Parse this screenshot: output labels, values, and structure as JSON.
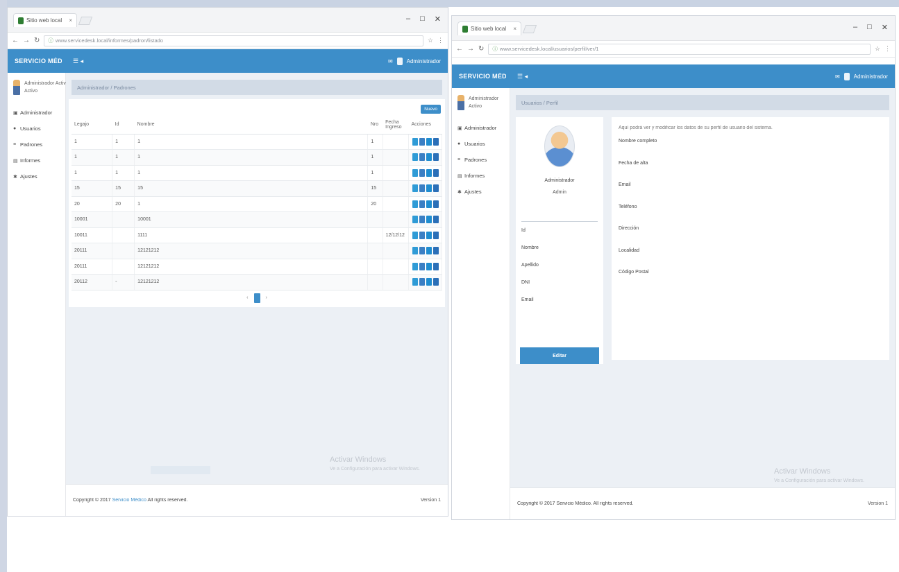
{
  "win1": {
    "tab_title": "Sitio web local",
    "url": "www.servicedesk.local/informes/padron/listado",
    "brand": "SERVICIO MÉDICO",
    "head_user": "Administrador",
    "user_name": "Administrador Activo",
    "user_sub": "Activo",
    "sidebar": [
      {
        "icon": "home-icon",
        "label": "Administrador"
      },
      {
        "icon": "user-icon",
        "label": "Usuarios"
      },
      {
        "icon": "list-icon",
        "label": "Padrones"
      },
      {
        "icon": "file-icon",
        "label": "Informes"
      },
      {
        "icon": "cog-icon",
        "label": "Ajustes"
      }
    ],
    "breadcrumb": "Administrador / Padrones",
    "add_label": "Nuevo",
    "columns": [
      "Legajo",
      "Id",
      "Nombre",
      "Nro",
      "Fecha Ingreso",
      "Acciones"
    ],
    "rows": [
      [
        "1",
        "1",
        "1",
        "1",
        ""
      ],
      [
        "1",
        "1",
        "1",
        "1",
        ""
      ],
      [
        "1",
        "1",
        "1",
        "1",
        ""
      ],
      [
        "15",
        "15",
        "15",
        "15",
        ""
      ],
      [
        "20",
        "20",
        "1",
        "20",
        ""
      ],
      [
        "10001",
        "",
        "10001",
        "",
        ""
      ],
      [
        "10011",
        "",
        "1111",
        "",
        "12/12/12"
      ],
      [
        "20111",
        "",
        "12121212",
        "",
        ""
      ],
      [
        "20111",
        "",
        "12121212",
        "",
        ""
      ],
      [
        "20112",
        "-",
        "12121212",
        "",
        ""
      ]
    ],
    "pager_prev": "‹",
    "pager_next": "›",
    "footer_copy": "Copyright © 2017 ",
    "footer_link": "Servicio Médico",
    "footer_rights": " All rights reserved.",
    "footer_ver": "Version 1",
    "watermark_title": "Activar Windows",
    "watermark_sub": "Ve a Configuración para activar Windows."
  },
  "win2": {
    "tab_title": "Sitio web local",
    "url": "www.servicedesk.local/usuarios/perfil/ver/1",
    "brand": "SERVICIO MÉDICO",
    "head_user": "Administrador",
    "user_name": "Administrador",
    "user_sub": "Activo",
    "sidebar": [
      {
        "icon": "home-icon",
        "label": "Administrador"
      },
      {
        "icon": "user-icon",
        "label": "Usuarios"
      },
      {
        "icon": "list-icon",
        "label": "Padrones"
      },
      {
        "icon": "file-icon",
        "label": "Informes"
      },
      {
        "icon": "cog-icon",
        "label": "Ajustes"
      }
    ],
    "breadcrumb": "Usuarios / Perfil",
    "profile_name": "Administrador",
    "profile_role": "Admin",
    "profile_items": [
      "Id",
      "Nombre",
      "Apellido",
      "DNI",
      "Email"
    ],
    "profile_button": "Editar",
    "intro": "Aquí podrá ver y modificar los datos de su perfil de usuario del sistema.",
    "fields": [
      "Nombre completo",
      "Fecha de alta",
      "Email",
      "Teléfono",
      "Dirección",
      "Localidad",
      "Código Postal"
    ],
    "footer_copy": "Copyright © 2017 Servicio Médico. All rights reserved.",
    "footer_ver": "Version 1",
    "watermark_title": "Activar Windows",
    "watermark_sub": "Ve a Configuración para activar Windows."
  }
}
